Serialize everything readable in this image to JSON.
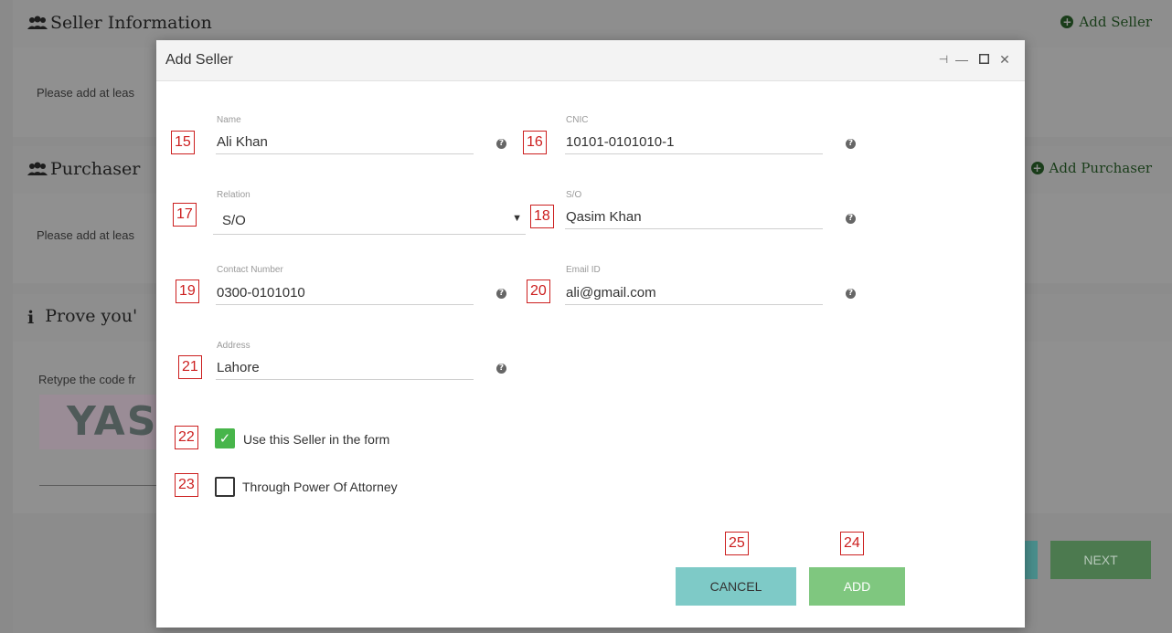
{
  "background": {
    "seller_section_title": "Seller Information",
    "seller_add_link": "Add Seller",
    "seller_placeholder": "Please add at leas",
    "purchaser_section_title": "Purchaser",
    "purchaser_add_link": "Add Purchaser",
    "purchaser_placeholder": "Please add at leas",
    "captcha_section_title": "Prove you'",
    "captcha_instruction": "Retype the code fr",
    "captcha_image_text": "YAS",
    "next_button": "NEXT"
  },
  "modal": {
    "title": "Add Seller",
    "controls": [
      "pin-icon",
      "minimize-icon",
      "maximize-icon",
      "close-icon"
    ],
    "fields": {
      "name": {
        "label": "Name",
        "value": "Ali Khan",
        "marker": "15"
      },
      "cnic": {
        "label": "CNIC",
        "value": "10101-0101010-1",
        "marker": "16"
      },
      "relation": {
        "label": "Relation",
        "value": "S/O",
        "marker": "17"
      },
      "so": {
        "label": "S/O",
        "value": "Qasim Khan",
        "marker": "18"
      },
      "contact": {
        "label": "Contact Number",
        "value": "0300-0101010",
        "marker": "19"
      },
      "email": {
        "label": "Email ID",
        "value": "ali@gmail.com",
        "marker": "20"
      },
      "address": {
        "label": "Address",
        "value": "Lahore",
        "marker": "21"
      }
    },
    "checkboxes": {
      "use_seller": {
        "label": "Use this Seller in the form",
        "checked": true,
        "marker": "22"
      },
      "power_of_attorney": {
        "label": "Through Power Of Attorney",
        "checked": false,
        "marker": "23"
      }
    },
    "buttons": {
      "cancel": {
        "label": "CANCEL",
        "marker": "25"
      },
      "add": {
        "label": "ADD",
        "marker": "24"
      }
    }
  },
  "colors": {
    "cancel_button": "#7ecac7",
    "add_button": "#7fc77f",
    "checkbox_checked": "#47b54a",
    "marker_red": "#cc1f1f"
  }
}
